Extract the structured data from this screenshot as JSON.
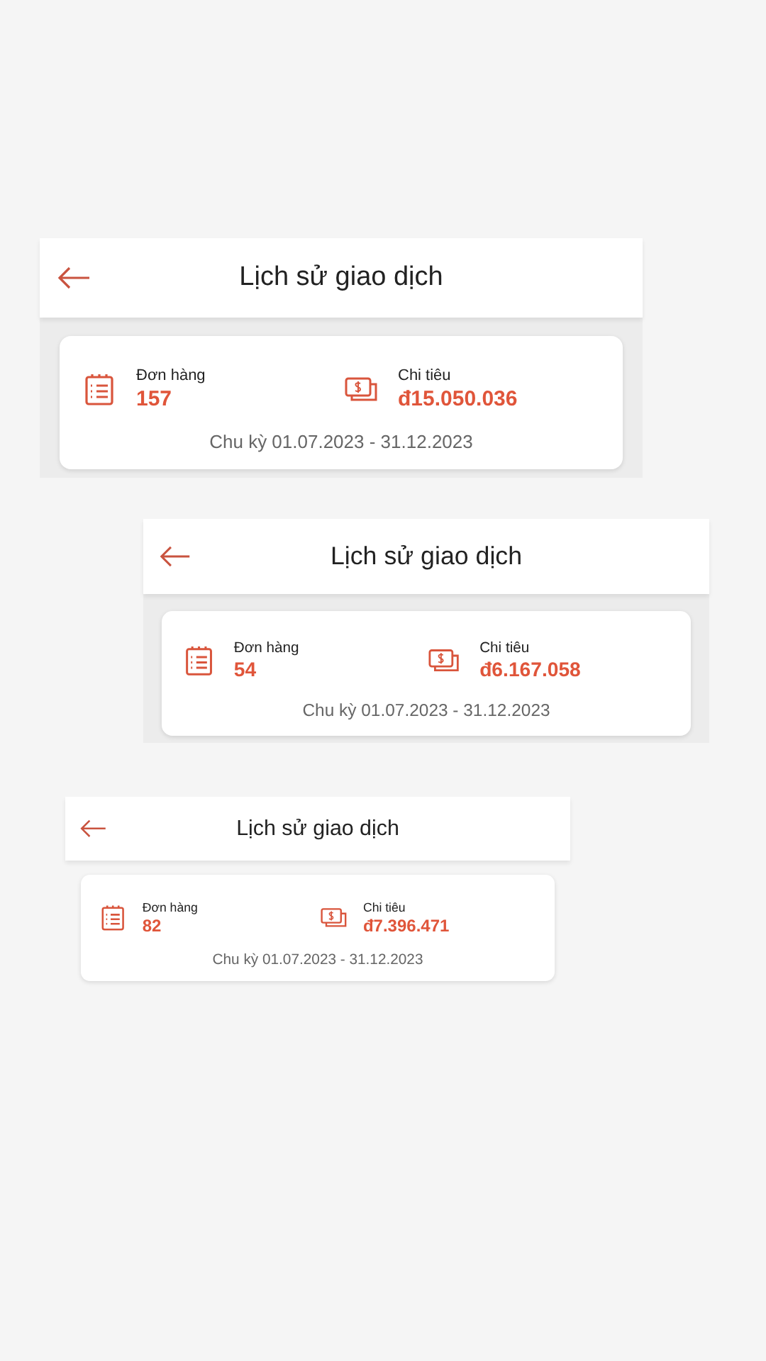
{
  "screenshots": [
    {
      "title": "Lịch sử giao dịch",
      "orders_label": "Đơn hàng",
      "orders_value": "157",
      "spend_label": "Chi tiêu",
      "spend_value": "đ15.050.036",
      "period": "Chu kỳ 01.07.2023 - 31.12.2023"
    },
    {
      "title": "Lịch sử giao dịch",
      "orders_label": "Đơn hàng",
      "orders_value": "54",
      "spend_label": "Chi tiêu",
      "spend_value": "đ6.167.058",
      "period": "Chu kỳ 01.07.2023 - 31.12.2023"
    },
    {
      "title": "Lịch sử giao dịch",
      "orders_label": "Đơn hàng",
      "orders_value": "82",
      "spend_label": "Chi tiêu",
      "spend_value": "đ7.396.471",
      "period": "Chu kỳ 01.07.2023 - 31.12.2023"
    }
  ]
}
